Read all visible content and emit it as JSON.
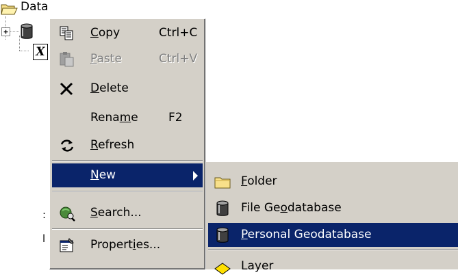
{
  "tree": {
    "root_label": "Data",
    "root_icon": "folder-open-icon",
    "child_icons": [
      "database-icon",
      "toolbox-x-icon"
    ],
    "expander": "+",
    "x_glyph": "X",
    "fragment_1": ":",
    "fragment_2": "l"
  },
  "context_menu": {
    "items": [
      {
        "pre": "",
        "u": "C",
        "post": "opy",
        "shortcut": "Ctrl+C",
        "icon": "copy-icon",
        "enabled": true
      },
      {
        "pre": "",
        "u": "P",
        "post": "aste",
        "shortcut": "Ctrl+V",
        "icon": "paste-icon",
        "enabled": false
      },
      {
        "pre": "",
        "u": "D",
        "post": "elete",
        "shortcut": "",
        "icon": "delete-x-icon",
        "enabled": true
      },
      {
        "pre": "Rena",
        "u": "m",
        "post": "e",
        "shortcut": "F2",
        "icon": "",
        "enabled": true
      },
      {
        "pre": "",
        "u": "R",
        "post": "efresh",
        "shortcut": "",
        "icon": "refresh-icon",
        "enabled": true
      },
      {
        "pre": "",
        "u": "N",
        "post": "ew",
        "shortcut": "",
        "icon": "",
        "enabled": true,
        "selected": true,
        "submenu": true
      },
      {
        "pre": "",
        "u": "S",
        "post": "earch...",
        "shortcut": "",
        "icon": "search-icon",
        "enabled": true
      },
      {
        "pre": "Propert",
        "u": "i",
        "post": "es...",
        "shortcut": "",
        "icon": "properties-icon",
        "enabled": true
      }
    ]
  },
  "submenu_new": {
    "items": [
      {
        "pre": "",
        "u": "F",
        "post": "older",
        "icon": "folder-icon"
      },
      {
        "pre": "File Ge",
        "u": "o",
        "post": "database",
        "icon": "database-icon"
      },
      {
        "pre": "",
        "u": "P",
        "post": "ersonal Geodatabase",
        "icon": "database-icon",
        "selected": true
      },
      {
        "pre": "",
        "u": "",
        "post": "Layer",
        "icon": "layer-icon"
      }
    ]
  },
  "colors": {
    "menu_bg": "#d4d0c8",
    "highlight": "#0a246a",
    "disabled_text": "#808080"
  }
}
